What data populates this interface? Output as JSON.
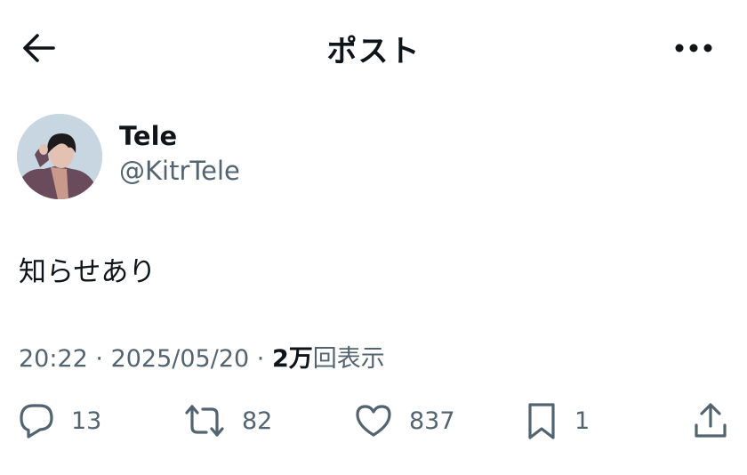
{
  "header": {
    "title": "ポスト",
    "back_icon": "arrow-left-icon",
    "more_icon": "more-horizontal-icon"
  },
  "author": {
    "display_name": "Tele",
    "handle": "@KitrTele",
    "avatar_icon": "avatar-photo"
  },
  "post": {
    "text": "知らせあり"
  },
  "meta": {
    "time": "20:22",
    "separator1": " · ",
    "date": "2025/05/20",
    "separator2": " · ",
    "views_count": "2万",
    "views_label": "回表示"
  },
  "actions": {
    "reply": {
      "icon": "reply-icon",
      "count": "13"
    },
    "repost": {
      "icon": "repost-icon",
      "count": "82"
    },
    "like": {
      "icon": "heart-icon",
      "count": "837"
    },
    "bookmark": {
      "icon": "bookmark-icon",
      "count": "1"
    },
    "share": {
      "icon": "share-icon"
    }
  },
  "colors": {
    "text": "#0f1419",
    "secondary": "#536471",
    "background": "#ffffff"
  }
}
